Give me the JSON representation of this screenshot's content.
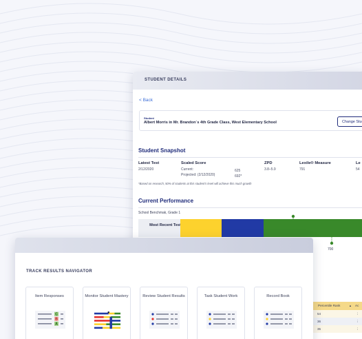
{
  "student_details": {
    "header": "STUDENT DETAILS",
    "back_label": "< Back",
    "student_caption": "Student",
    "student_name": "Albert Morris in Mr. Brandon`s 4th Grade Class, West Elementary School",
    "change_button": "Change Stud"
  },
  "snapshot": {
    "title": "Student Snapshot",
    "latest_test": {
      "label": "Latest Test",
      "value": "2/12/2020"
    },
    "scaled_score": {
      "label": "Scaled Score",
      "current_label": "Current:",
      "current_value": "625",
      "projected_label": "Projected: (2/12/2020)",
      "projected_value": "692*"
    },
    "zpd": {
      "label": "ZPD",
      "value": "3.8–5.9"
    },
    "lexile": {
      "label": "Lexile® Measure",
      "value": "791"
    },
    "extra": {
      "label": "Le",
      "value": "54"
    },
    "footnote": "*Based on research, 50% of students at this student's level will achieve this much growth"
  },
  "performance": {
    "title": "Current Performance",
    "benchmark": "School Benchmak, Grade 1",
    "row_label": "Most Recent Test",
    "tick_value": "700"
  },
  "percentile_table": {
    "header": "Percentile Rank",
    "sort_arrow": "▲",
    "header_extra": "Ac",
    "rows": [
      "54",
      "36",
      "35"
    ],
    "row_menu": "⋮"
  },
  "navigator": {
    "title": "TRACK RESULTS NAVIGATOR",
    "cards": [
      {
        "label": "Item Responses",
        "icon": "item-responses-icon"
      },
      {
        "label": "Monitor Student Mastery",
        "icon": "mastery-chart-icon"
      },
      {
        "label": "Review Student Results",
        "icon": "results-list-icon"
      },
      {
        "label": "Task Student Work",
        "icon": "task-list-icon"
      },
      {
        "label": "Record Book",
        "icon": "record-book-icon"
      }
    ],
    "item_marks": [
      "C",
      "B",
      "A"
    ]
  },
  "colors": {
    "navy": "#1f2b7a",
    "yellow": "#fdd22d",
    "blue": "#213aa5",
    "green": "#39892a",
    "red": "#e5322d",
    "link": "#3d6fd8"
  }
}
